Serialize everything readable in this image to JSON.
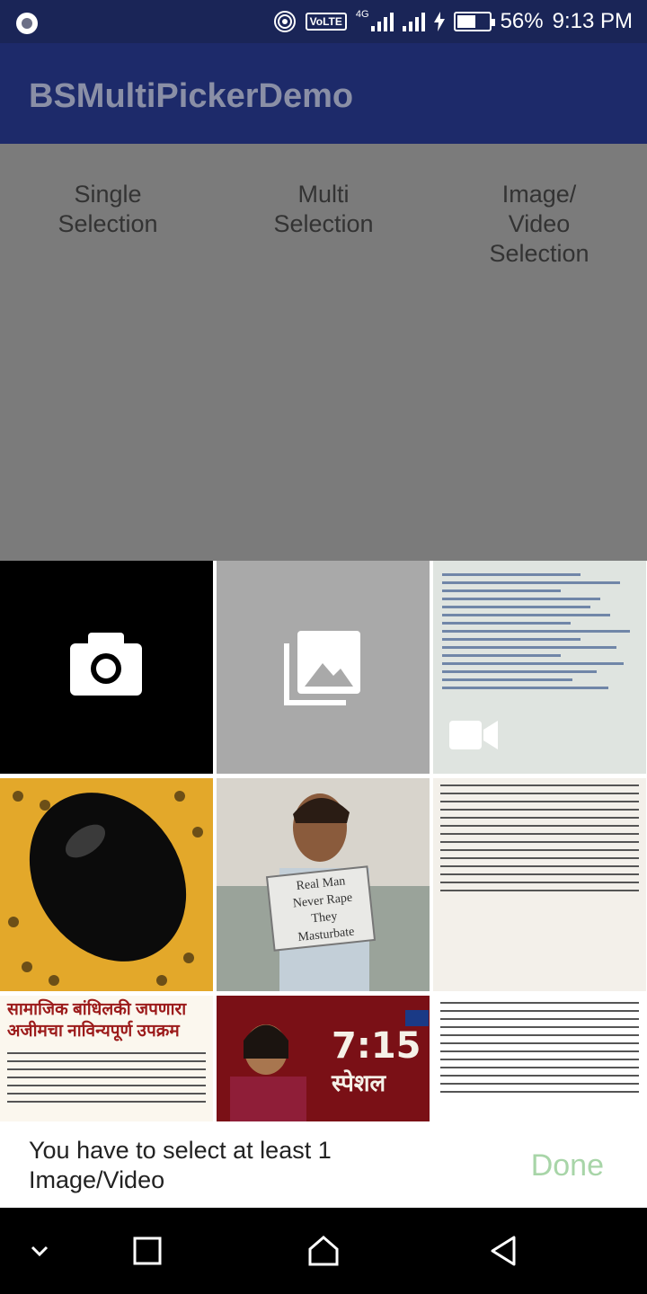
{
  "status_bar": {
    "network": "VoLTE",
    "network_gen": "4G",
    "battery": "56%",
    "time": "9:13 PM"
  },
  "app_bar": {
    "title": "BSMultiPickerDemo"
  },
  "selection_buttons": [
    {
      "label": "Single Selection",
      "lines": [
        "Single",
        "Selection"
      ]
    },
    {
      "label": "Multi Selection",
      "lines": [
        "Multi",
        "Selection"
      ]
    },
    {
      "label": "Image/ Video Selection",
      "lines": [
        "Image/",
        "Video",
        "Selection"
      ]
    }
  ],
  "picker": {
    "message_lines": [
      "You have to select at least 1",
      "Image/Video"
    ],
    "done_label": "Done",
    "done_color": "#a8d5a8",
    "thumbnails": [
      {
        "icon": "camera-icon"
      },
      {
        "icon": "gallery-icon"
      },
      {
        "icon": "video-icon"
      },
      {
        "sign_lines": [
          "Real Man",
          "Never Rape",
          "They",
          "Masturbate"
        ]
      },
      {
        "headline": [
          "सामाजिक बांधिलकी जपणारा",
          "अजीमचा नाविन्यपूर्ण उपक्रम"
        ]
      },
      {
        "tv_text": [
          "7:15",
          "स्पेशल"
        ]
      }
    ]
  },
  "colors": {
    "status_bar": "#1a2557",
    "app_bar": "#1d2a6a",
    "overlay": "#7b7b7b"
  }
}
